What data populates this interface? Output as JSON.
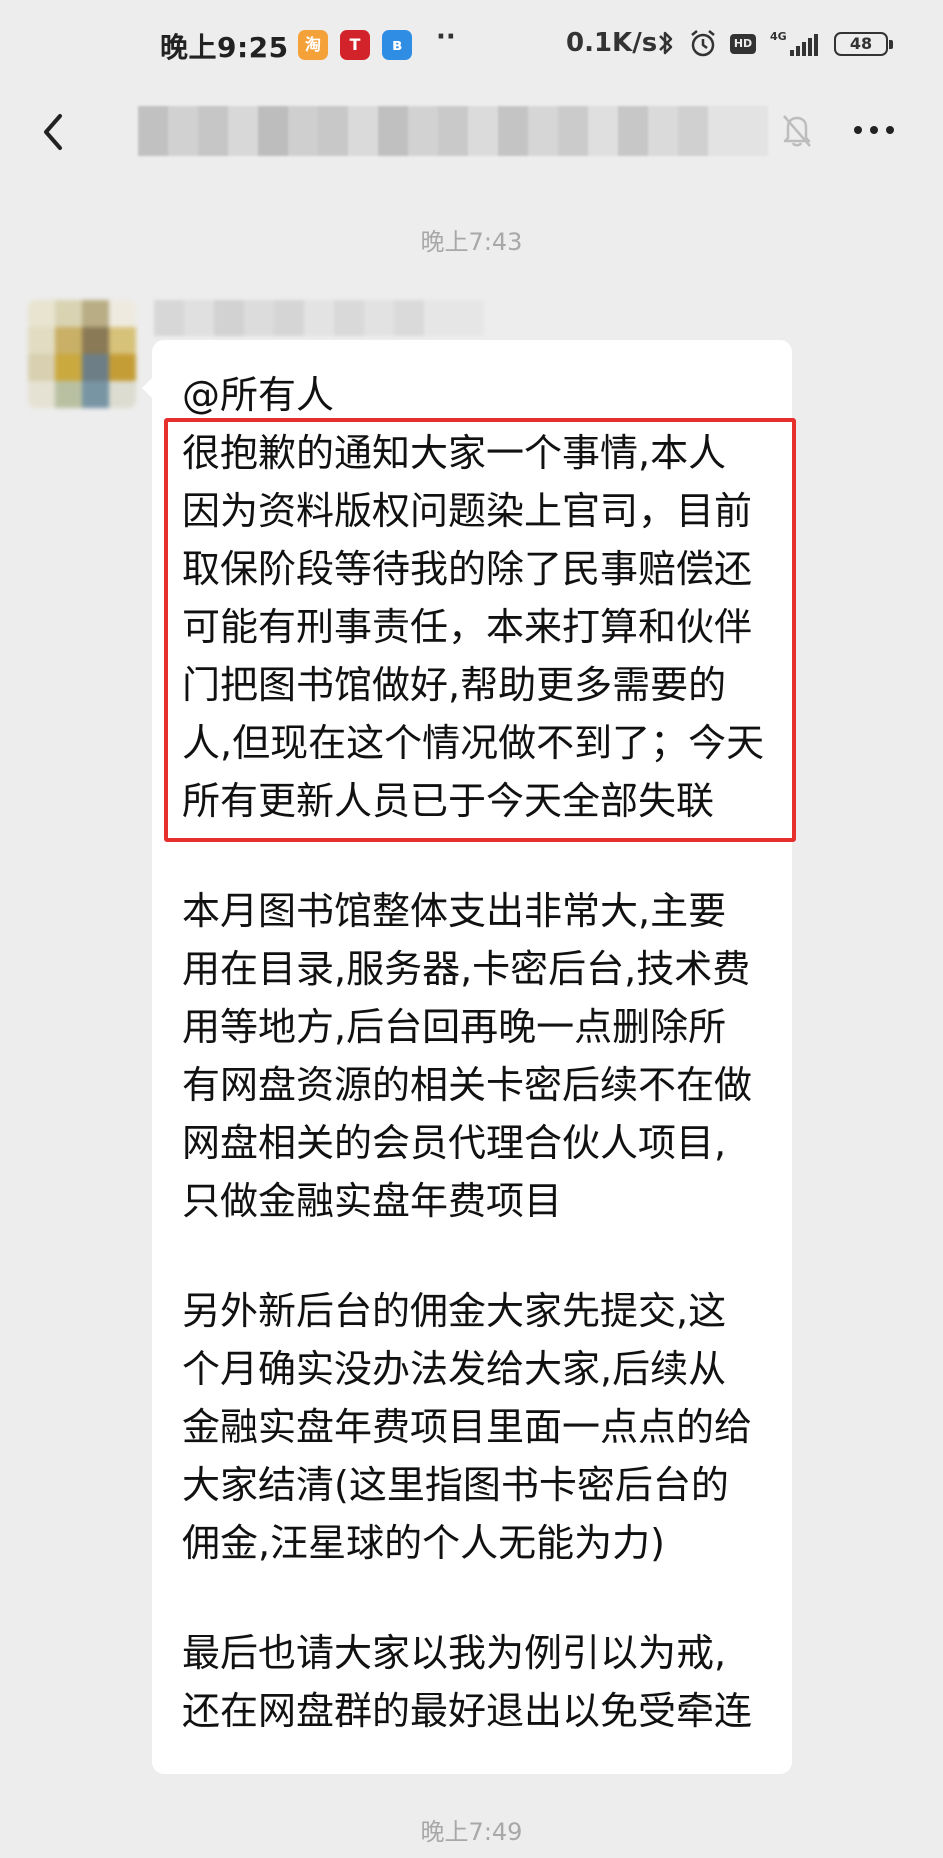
{
  "status_bar": {
    "time": "晚上9:25",
    "dots": "··",
    "net_speed": "0.1K/s",
    "hd_label": "HD",
    "net_type": "4G",
    "battery": "48",
    "app_icons": [
      {
        "name": "taobao-app-icon",
        "glyph": "淘",
        "color": "#f5a13a"
      },
      {
        "name": "tesla-app-icon",
        "glyph": "T",
        "color": "#d3232a"
      },
      {
        "name": "bluetooth-app-icon",
        "glyph": "ʙ",
        "color": "#2f8de4"
      }
    ]
  },
  "messages": {
    "timestamp_top": "晚上7:43",
    "timestamp_bottom": "晚上7:49",
    "mention": "@所有人",
    "highlighted_lines": [
      "很抱歉的通知大家一个事情,本人",
      "因为资料版权问题染上官司，目前",
      "取保阶段等待我的除了民事赔偿还",
      "可能有刑事责任，本来打算和伙伴",
      "门把图书馆做好,帮助更多需要的",
      "人,但现在这个情况做不到了；今天",
      "所有更新人员已于今天全部失联"
    ],
    "paragraph_2": [
      "本月图书馆整体支出非常大,主要",
      "用在目录,服务器,卡密后台,技术费",
      "用等地方,后台回再晚一点删除所",
      "有网盘资源的相关卡密后续不在做",
      "网盘相关的会员代理合伙人项目,",
      "只做金融实盘年费项目"
    ],
    "paragraph_3": [
      "另外新后台的佣金大家先提交,这",
      "个月确实没办法发给大家,后续从",
      "金融实盘年费项目里面一点点的给",
      "大家结清(这里指图书卡密后台的",
      "佣金,汪星球的个人无能为力)"
    ],
    "paragraph_4": [
      "最后也请大家以我为例引以为戒,",
      "还在网盘群的最好退出以免受牵连"
    ]
  }
}
